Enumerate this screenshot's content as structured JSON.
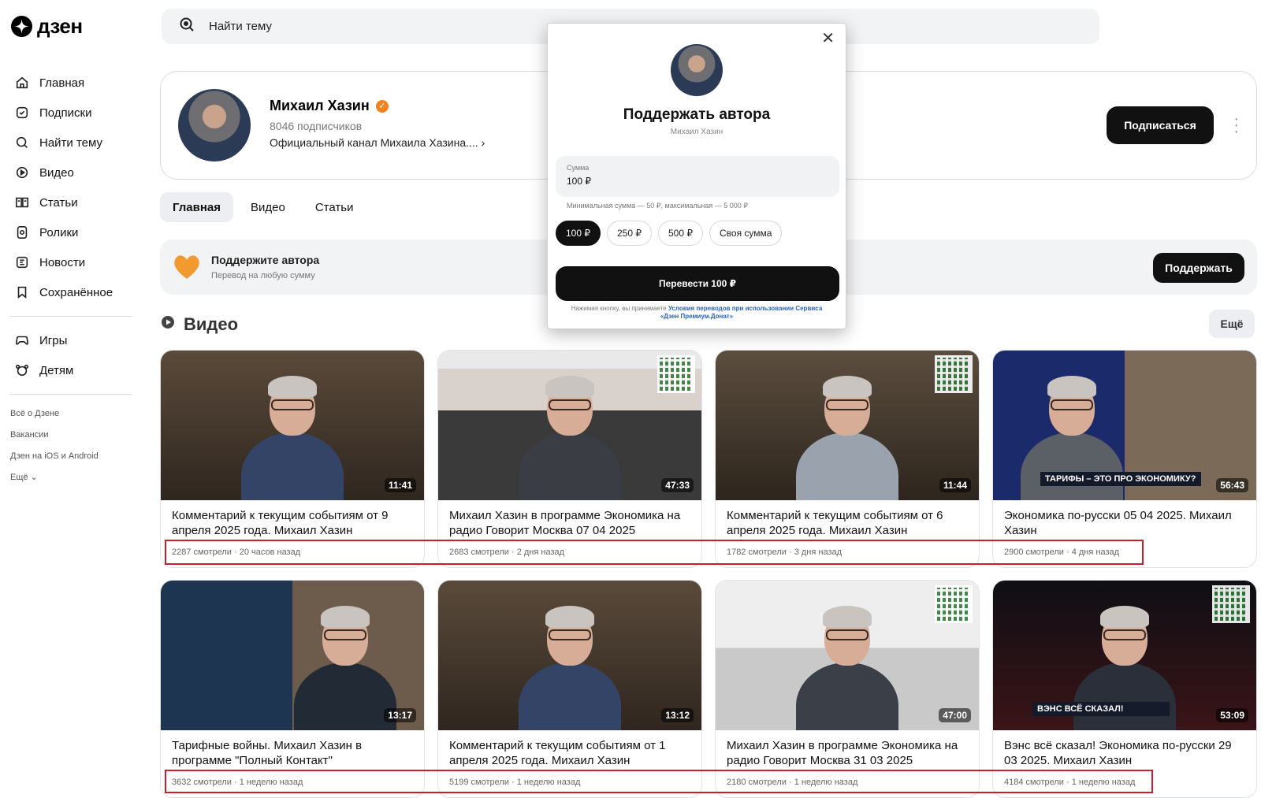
{
  "brand": {
    "logo_text": "дзен"
  },
  "search": {
    "placeholder": "Найти тему"
  },
  "sidebar": {
    "items": [
      {
        "label": "Главная",
        "icon": "home-icon"
      },
      {
        "label": "Подписки",
        "icon": "subscriptions-icon"
      },
      {
        "label": "Найти тему",
        "icon": "search-icon"
      },
      {
        "label": "Видео",
        "icon": "video-icon"
      },
      {
        "label": "Статьи",
        "icon": "articles-icon"
      },
      {
        "label": "Ролики",
        "icon": "shorts-icon"
      },
      {
        "label": "Новости",
        "icon": "news-icon"
      },
      {
        "label": "Сохранённое",
        "icon": "bookmark-icon"
      }
    ],
    "extra_items": [
      {
        "label": "Игры",
        "icon": "gamepad-icon"
      },
      {
        "label": "Детям",
        "icon": "kids-icon"
      }
    ],
    "footer_links": [
      "Всё о Дзене",
      "Вакансии",
      "Дзен на iOS и Android",
      "Ещё"
    ]
  },
  "channel": {
    "name": "Михаил Хазин",
    "subscribers": "8046 подписчиков",
    "description": "Официальный канал Михаила Хазина....",
    "subscribe_label": "Подписаться"
  },
  "tabs": [
    "Главная",
    "Видео",
    "Статьи"
  ],
  "support_banner": {
    "title": "Поддержите автора",
    "subtitle": "Перевод на любую сумму",
    "button_label": "Поддержать"
  },
  "videos_section": {
    "title": "Видео",
    "more_label": "Ещё",
    "videos": [
      {
        "title": "Комментарий к текущим событиям от 9 апреля 2025 года. Михаил Хазин",
        "meta": "2287 смотрели · 20 часов назад",
        "duration": "11:41"
      },
      {
        "title": "Михаил Хазин в программе Экономика на радио Говорит Москва 07 04 2025",
        "meta": "2683 смотрели · 2 дня назад",
        "duration": "47:33"
      },
      {
        "title": "Комментарий к текущим событиям от 6 апреля 2025 года. Михаил Хазин",
        "meta": "1782 смотрели · 3 дня назад",
        "duration": "11:44"
      },
      {
        "title": "Экономика по-русски 05 04 2025. Михаил Хазин",
        "meta": "2900 смотрели · 4 дня назад",
        "duration": "56:43",
        "banner": "ТАРИФЫ – ЭТО ПРО ЭКОНОМИКУ?"
      },
      {
        "title": "Тарифные войны. Михаил Хазин в программе \"Полный Контакт\"",
        "meta": "3632 смотрели · 1 неделю назад",
        "duration": "13:17"
      },
      {
        "title": "Комментарий к текущим событиям от 1 апреля 2025 года. Михаил Хазин",
        "meta": "5199 смотрели · 1 неделю назад",
        "duration": "13:12"
      },
      {
        "title": "Михаил Хазин в программе Экономика на радио Говорит Москва 31 03 2025",
        "meta": "2180 смотрели · 1 неделю назад",
        "duration": "47:00"
      },
      {
        "title": "Вэнс всё сказал! Экономика по-русски 29 03 2025. Михаил Хазин",
        "meta": "4184 смотрели · 1 неделю назад",
        "duration": "53:09",
        "banner": "ВЭНС ВСЁ СКАЗАЛ!"
      }
    ]
  },
  "donate_modal": {
    "title": "Поддержать автора",
    "author": "Михаил Хазин",
    "amount_label": "Сумма",
    "amount_value": "100 ₽",
    "hint": "Минимальная сумма — 50 ₽, максимальная — 5 000 ₽",
    "chips": [
      "100 ₽",
      "250 ₽",
      "500 ₽",
      "Своя сумма"
    ],
    "pay_label": "Перевести 100 ₽",
    "legal_text": "Нажимая кнопку, вы принимаете",
    "legal_link": "Условия переводов при использовании Сервиса «Дзен Премиум.Донат»"
  },
  "colors": {
    "accent": "#111111",
    "verify": "#f08222",
    "highlight": "#cc1d2b"
  }
}
